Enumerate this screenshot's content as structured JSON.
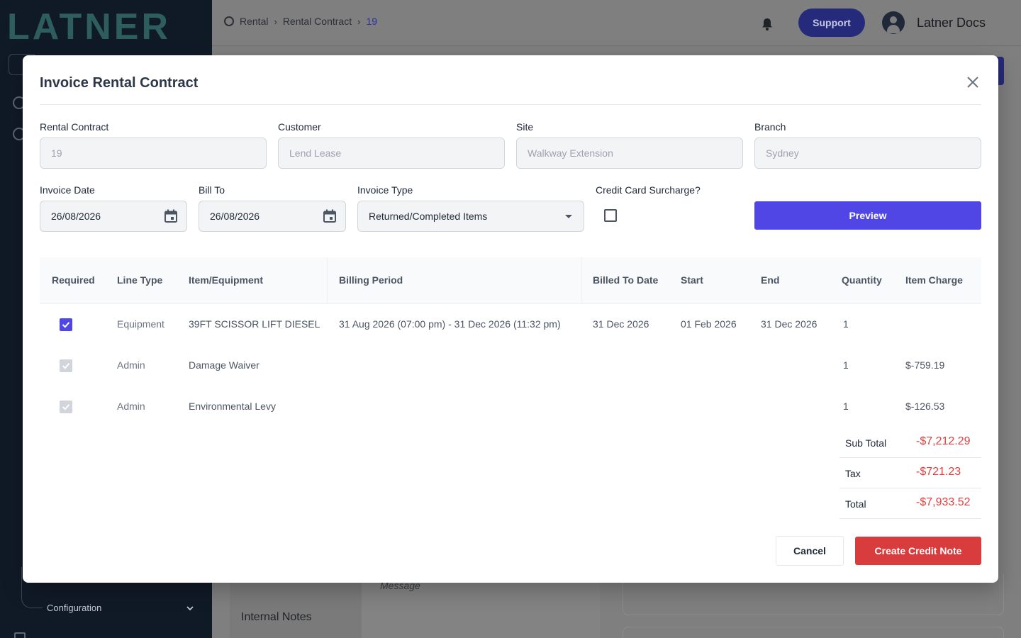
{
  "app": {
    "logo_text": "LATNER",
    "breadcrumb": [
      "Rental",
      "Rental Contract",
      "19"
    ],
    "support_label": "Support",
    "user_name": "Latner Docs",
    "sidebar_config_label": "Configuration",
    "bg_message_placeholder": "Message",
    "bg_internal_notes": "Internal Notes"
  },
  "modal": {
    "title": "Invoice Rental Contract",
    "fields": {
      "rental_contract": {
        "label": "Rental Contract",
        "value": "19"
      },
      "customer": {
        "label": "Customer",
        "value": "Lend Lease"
      },
      "site": {
        "label": "Site",
        "value": "Walkway Extension"
      },
      "branch": {
        "label": "Branch",
        "value": "Sydney"
      },
      "invoice_date": {
        "label": "Invoice Date",
        "value": "26/08/2026"
      },
      "bill_to": {
        "label": "Bill To",
        "value": "26/08/2026"
      },
      "invoice_type": {
        "label": "Invoice Type",
        "value": "Returned/Completed Items"
      },
      "credit_card_surcharge": {
        "label": "Credit Card Surcharge?",
        "checked": false
      }
    },
    "preview_label": "Preview",
    "table": {
      "headers": [
        "Required",
        "Line Type",
        "Item/Equipment",
        "Billing Period",
        "Billed To Date",
        "Start",
        "End",
        "Quantity",
        "Item Charge"
      ],
      "rows": [
        {
          "required": true,
          "editable": true,
          "line_type": "Equipment",
          "item": "39FT SCISSOR LIFT DIESEL",
          "billing_period": "31 Aug 2026 (07:00 pm) - 31 Dec 2026 (11:32 pm)",
          "billed_to_date": "31 Dec 2026",
          "start": "01 Feb 2026",
          "end": "31 Dec 2026",
          "quantity": "1",
          "item_charge": ""
        },
        {
          "required": true,
          "editable": false,
          "line_type": "Admin",
          "item": "Damage Waiver",
          "billing_period": "",
          "billed_to_date": "",
          "start": "",
          "end": "",
          "quantity": "1",
          "item_charge": "$-759.19"
        },
        {
          "required": true,
          "editable": false,
          "line_type": "Admin",
          "item": "Environmental Levy",
          "billing_period": "",
          "billed_to_date": "",
          "start": "",
          "end": "",
          "quantity": "1",
          "item_charge": "$-126.53"
        }
      ]
    },
    "totals": {
      "sub_total_label": "Sub Total",
      "sub_total": "-$7,212.29",
      "tax_label": "Tax",
      "tax": "-$721.23",
      "total_label": "Total",
      "total": "-$7,933.52"
    },
    "cancel_label": "Cancel",
    "create_label": "Create Credit Note"
  },
  "colors": {
    "primary": "#4f46e5",
    "danger": "#d93c3c",
    "negative_text": "#e53e3e",
    "sidebar_bg": "#101a27"
  }
}
